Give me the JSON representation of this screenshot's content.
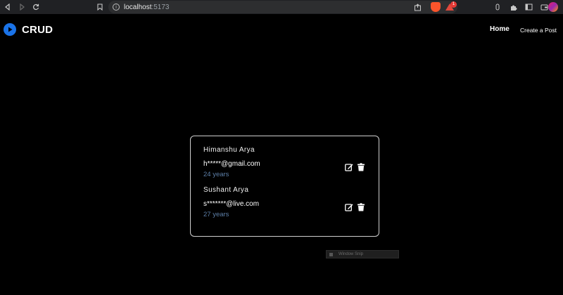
{
  "browser": {
    "url_host": "localhost",
    "url_port": ":5173",
    "rewards_badge": "1"
  },
  "navbar": {
    "brand": "CRUD",
    "links": [
      "Home",
      "Create a Post"
    ]
  },
  "users": [
    {
      "name": "Himanshu Arya",
      "email": "h*****@gmail.com",
      "age": "24 years"
    },
    {
      "name": "Sushant Arya",
      "email": "s*******@live.com",
      "age": "27 years"
    }
  ],
  "tooltip": {
    "label": "Window Snip"
  },
  "colors": {
    "background": "#000000",
    "accent": "#1a73e8",
    "age_text": "#5d7fa8",
    "card_border": "#cfcfcf"
  }
}
